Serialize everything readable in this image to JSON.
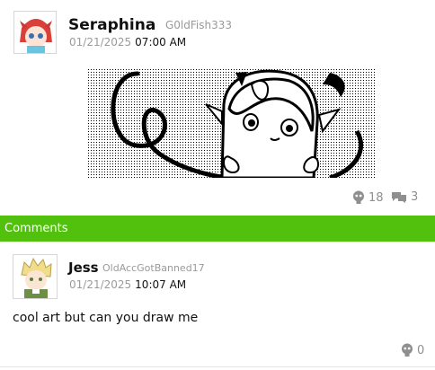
{
  "post": {
    "author_name": "Seraphina",
    "author_handle": "G0ldFish333",
    "date": "01/21/2025",
    "time": "07:00 AM",
    "likes": "18",
    "replies": "3"
  },
  "comments_header": "Comments",
  "comments": [
    {
      "author_name": "Jess",
      "author_handle": "OldAccGotBanned17",
      "date": "01/21/2025",
      "time": "10:07 AM",
      "text": "cool art but can you draw me",
      "likes": "0"
    }
  ],
  "colors": {
    "comments_bar": "#52c10e",
    "muted_text": "#9a9a9a"
  },
  "icons": {
    "like": "smiley-head-icon",
    "reply": "speech-bubbles-icon"
  }
}
